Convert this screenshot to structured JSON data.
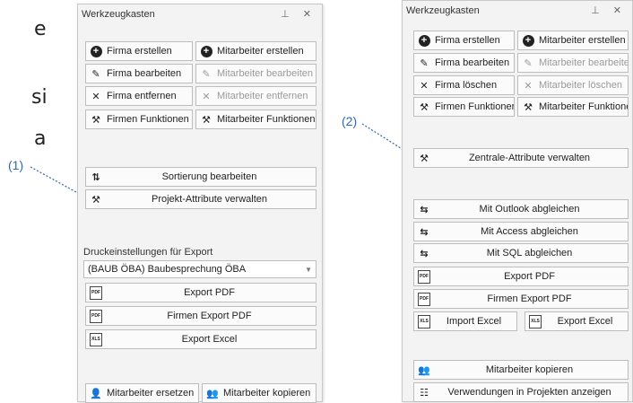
{
  "background_text": {
    "line1": "e",
    "line2": "si",
    "line3": "a"
  },
  "callouts": {
    "one": "(1)",
    "two": "(2)"
  },
  "left_panel": {
    "title": "Werkzeugkasten",
    "tools": "⊥ ✕",
    "buttons": {
      "firma_erstellen": "Firma erstellen",
      "mitarbeiter_erstellen": "Mitarbeiter erstellen",
      "firma_bearbeiten": "Firma bearbeiten",
      "mitarbeiter_bearbeiten": "Mitarbeiter bearbeiten",
      "firma_entfernen": "Firma entfernen",
      "mitarbeiter_entfernen": "Mitarbeiter entfernen",
      "firmen_funktionen": "Firmen Funktionen",
      "mitarbeiter_funktionen": "Mitarbeiter Funktionen",
      "sortierung": "Sortierung bearbeiten",
      "projekt_attribute": "Projekt-Attribute verwalten",
      "export_pdf": "Export PDF",
      "firmen_export_pdf": "Firmen Export PDF",
      "export_excel": "Export Excel",
      "mitarbeiter_ersetzen": "Mitarbeiter ersetzen",
      "mitarbeiter_kopieren": "Mitarbeiter kopieren"
    },
    "druck_label": "Druckeinstellungen für Export",
    "druck_value": "(BAUB ÖBA) Baubesprechung ÖBA"
  },
  "right_panel": {
    "title": "Werkzeugkasten",
    "tools": "⊥ ✕",
    "buttons": {
      "firma_erstellen": "Firma erstellen",
      "mitarbeiter_erstellen": "Mitarbeiter erstellen",
      "firma_bearbeiten": "Firma bearbeiten",
      "mitarbeiter_bearbeiten": "Mitarbeiter bearbeiten",
      "firma_loeschen": "Firma löschen",
      "mitarbeiter_loeschen": "Mitarbeiter löschen",
      "firmen_funktionen": "Firmen Funktionen",
      "mitarbeiter_funktionen": "Mitarbeiter Funktionen",
      "zentrale_attribute": "Zentrale-Attribute verwalten",
      "outlook": "Mit Outlook abgleichen",
      "access": "Mit Access abgleichen",
      "sql": "Mit SQL abgleichen",
      "export_pdf": "Export PDF",
      "firmen_export_pdf": "Firmen Export PDF",
      "import_excel": "Import Excel",
      "export_excel": "Export Excel",
      "mitarbeiter_kopieren": "Mitarbeiter kopieren",
      "verwendungen": "Verwendungen in Projekten anzeigen"
    }
  },
  "icons": {
    "plus": "plus-circle-icon",
    "edit": "edit-icon",
    "remove": "x-icon",
    "tools": "tools-icon",
    "sort": "sort-icon",
    "pdf": "pdf-icon",
    "xls": "excel-icon",
    "sync": "sync-icon",
    "person": "person-icon"
  }
}
